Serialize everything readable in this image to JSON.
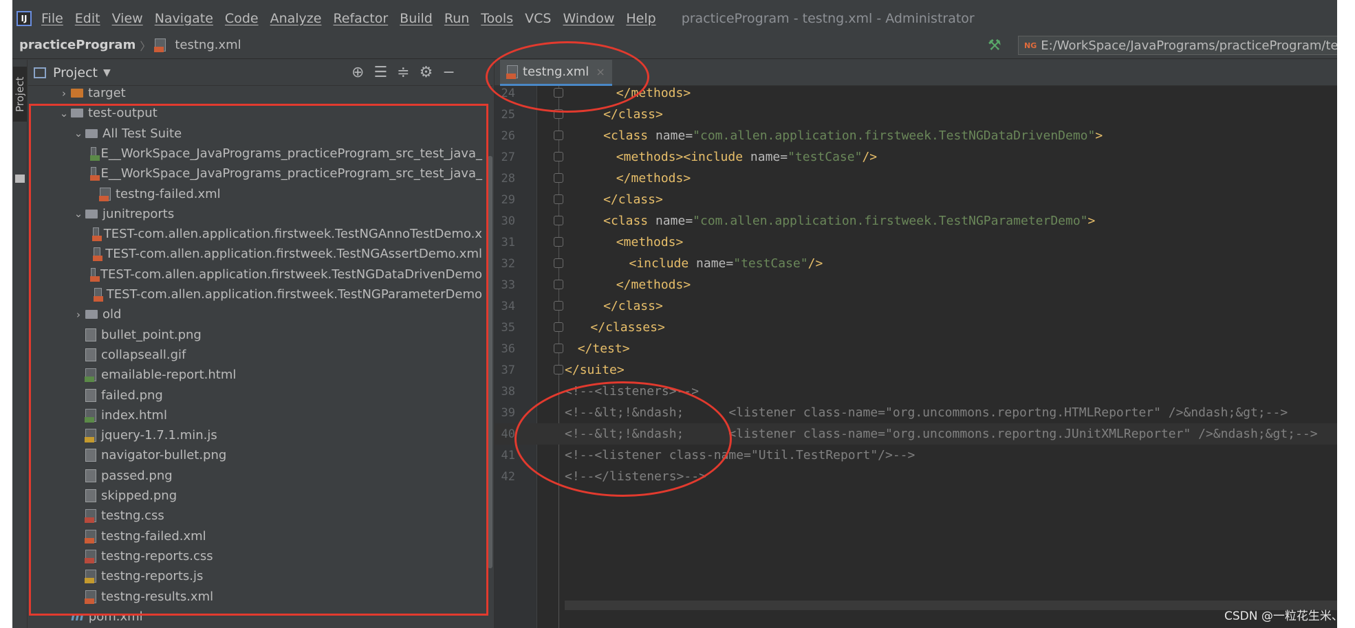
{
  "menubar": {
    "items": [
      "File",
      "Edit",
      "View",
      "Navigate",
      "Code",
      "Analyze",
      "Refactor",
      "Build",
      "Run",
      "Tools",
      "VCS",
      "Window",
      "Help"
    ],
    "window_title": "practiceProgram - testng.xml - Administrator"
  },
  "navbar": {
    "project": "practiceProgram",
    "file": "testng.xml",
    "run_config_path": "E:/WorkSpace/JavaPrograms/practiceProgram/te"
  },
  "stripe": {
    "label": "Project"
  },
  "project_panel": {
    "title": "Project",
    "tree": [
      {
        "label": "target",
        "kind": "folder-orange",
        "indent": 0,
        "chevron": "right"
      },
      {
        "label": "test-output",
        "kind": "folder",
        "indent": 0,
        "chevron": "down"
      },
      {
        "label": "All Test Suite",
        "kind": "folder",
        "indent": 1,
        "chevron": "down"
      },
      {
        "label": "E__WorkSpace_JavaPrograms_practiceProgram_src_test_java_",
        "kind": "html",
        "indent": 2,
        "chevron": ""
      },
      {
        "label": "E__WorkSpace_JavaPrograms_practiceProgram_src_test_java_",
        "kind": "xml",
        "indent": 2,
        "chevron": ""
      },
      {
        "label": "testng-failed.xml",
        "kind": "xml",
        "indent": 2,
        "chevron": ""
      },
      {
        "label": "junitreports",
        "kind": "folder",
        "indent": 1,
        "chevron": "down"
      },
      {
        "label": "TEST-com.allen.application.firstweek.TestNGAnnoTestDemo.x",
        "kind": "xml",
        "indent": 2,
        "chevron": ""
      },
      {
        "label": "TEST-com.allen.application.firstweek.TestNGAssertDemo.xml",
        "kind": "xml",
        "indent": 2,
        "chevron": ""
      },
      {
        "label": "TEST-com.allen.application.firstweek.TestNGDataDrivenDemo",
        "kind": "xml",
        "indent": 2,
        "chevron": ""
      },
      {
        "label": "TEST-com.allen.application.firstweek.TestNGParameterDemo",
        "kind": "xml",
        "indent": 2,
        "chevron": ""
      },
      {
        "label": "old",
        "kind": "folder",
        "indent": 1,
        "chevron": "right"
      },
      {
        "label": "bullet_point.png",
        "kind": "png",
        "indent": 1,
        "chevron": ""
      },
      {
        "label": "collapseall.gif",
        "kind": "png",
        "indent": 1,
        "chevron": ""
      },
      {
        "label": "emailable-report.html",
        "kind": "html",
        "indent": 1,
        "chevron": ""
      },
      {
        "label": "failed.png",
        "kind": "png",
        "indent": 1,
        "chevron": ""
      },
      {
        "label": "index.html",
        "kind": "html",
        "indent": 1,
        "chevron": ""
      },
      {
        "label": "jquery-1.7.1.min.js",
        "kind": "js",
        "indent": 1,
        "chevron": ""
      },
      {
        "label": "navigator-bullet.png",
        "kind": "png",
        "indent": 1,
        "chevron": ""
      },
      {
        "label": "passed.png",
        "kind": "png",
        "indent": 1,
        "chevron": ""
      },
      {
        "label": "skipped.png",
        "kind": "png",
        "indent": 1,
        "chevron": ""
      },
      {
        "label": "testng.css",
        "kind": "css",
        "indent": 1,
        "chevron": ""
      },
      {
        "label": "testng-failed.xml",
        "kind": "xml",
        "indent": 1,
        "chevron": ""
      },
      {
        "label": "testng-reports.css",
        "kind": "css",
        "indent": 1,
        "chevron": ""
      },
      {
        "label": "testng-reports.js",
        "kind": "js",
        "indent": 1,
        "chevron": ""
      },
      {
        "label": "testng-results.xml",
        "kind": "xml",
        "indent": 1,
        "chevron": ""
      },
      {
        "label": "pom.xml",
        "kind": "maven",
        "indent": 0,
        "chevron": ""
      }
    ]
  },
  "editor": {
    "tab": "testng.xml",
    "current_line": "40",
    "lines": [
      {
        "n": "24",
        "indent": 8,
        "parts": [
          [
            "br",
            "</"
          ],
          [
            "tag",
            "methods"
          ],
          [
            "br",
            ">"
          ]
        ]
      },
      {
        "n": "25",
        "indent": 6,
        "parts": [
          [
            "br",
            "</"
          ],
          [
            "tag",
            "class"
          ],
          [
            "br",
            ">"
          ]
        ]
      },
      {
        "n": "26",
        "indent": 6,
        "parts": [
          [
            "br",
            "<"
          ],
          [
            "tag",
            "class "
          ],
          [
            "attr",
            "name="
          ],
          [
            "val",
            "\"com.allen.application.firstweek.TestNGDataDrivenDemo\""
          ],
          [
            "br",
            ">"
          ]
        ]
      },
      {
        "n": "27",
        "indent": 8,
        "parts": [
          [
            "br",
            "<"
          ],
          [
            "tag",
            "methods"
          ],
          [
            "br",
            "><"
          ],
          [
            "tag",
            "include "
          ],
          [
            "attr",
            "name="
          ],
          [
            "val",
            "\"testCase\""
          ],
          [
            "br",
            "/>"
          ]
        ]
      },
      {
        "n": "28",
        "indent": 8,
        "parts": [
          [
            "br",
            "</"
          ],
          [
            "tag",
            "methods"
          ],
          [
            "br",
            ">"
          ]
        ]
      },
      {
        "n": "29",
        "indent": 6,
        "parts": [
          [
            "br",
            "</"
          ],
          [
            "tag",
            "class"
          ],
          [
            "br",
            ">"
          ]
        ]
      },
      {
        "n": "30",
        "indent": 6,
        "parts": [
          [
            "br",
            "<"
          ],
          [
            "tag",
            "class "
          ],
          [
            "attr",
            "name="
          ],
          [
            "val",
            "\"com.allen.application.firstweek.TestNGParameterDemo\""
          ],
          [
            "br",
            ">"
          ]
        ]
      },
      {
        "n": "31",
        "indent": 8,
        "parts": [
          [
            "br",
            "<"
          ],
          [
            "tag",
            "methods"
          ],
          [
            "br",
            ">"
          ]
        ]
      },
      {
        "n": "32",
        "indent": 10,
        "parts": [
          [
            "br",
            "<"
          ],
          [
            "tag",
            "include "
          ],
          [
            "attr",
            "name="
          ],
          [
            "val",
            "\"testCase\""
          ],
          [
            "br",
            "/>"
          ]
        ]
      },
      {
        "n": "33",
        "indent": 8,
        "parts": [
          [
            "br",
            "</"
          ],
          [
            "tag",
            "methods"
          ],
          [
            "br",
            ">"
          ]
        ]
      },
      {
        "n": "34",
        "indent": 6,
        "parts": [
          [
            "br",
            "</"
          ],
          [
            "tag",
            "class"
          ],
          [
            "br",
            ">"
          ]
        ]
      },
      {
        "n": "35",
        "indent": 4,
        "parts": [
          [
            "br",
            "</"
          ],
          [
            "tag",
            "classes"
          ],
          [
            "br",
            ">"
          ]
        ]
      },
      {
        "n": "36",
        "indent": 2,
        "parts": [
          [
            "br",
            "</"
          ],
          [
            "tag",
            "test"
          ],
          [
            "br",
            ">"
          ]
        ]
      },
      {
        "n": "37",
        "indent": 0,
        "parts": [
          [
            "br",
            "</"
          ],
          [
            "tag",
            "suite"
          ],
          [
            "br",
            ">"
          ]
        ]
      },
      {
        "n": "38",
        "indent": 0,
        "parts": [
          [
            "cmt",
            "<!--<listeners>-->"
          ]
        ]
      },
      {
        "n": "39",
        "indent": 0,
        "parts": [
          [
            "cmt",
            "<!--&lt;!&ndash;      <listener class-name=\"org.uncommons.reportng.HTMLReporter\" />&ndash;&gt;-->"
          ]
        ]
      },
      {
        "n": "40",
        "indent": 0,
        "parts": [
          [
            "cmt",
            "<!--&lt;!&ndash;      <listener class-name=\"org.uncommons.reportng.JUnitXMLReporter\" />&ndash;&gt;-->"
          ]
        ]
      },
      {
        "n": "41",
        "indent": 0,
        "parts": [
          [
            "cmt",
            "<!--<listener class-name=\"Util.TestReport\"/>-->"
          ]
        ]
      },
      {
        "n": "42",
        "indent": 0,
        "parts": [
          [
            "cmt",
            "<!--</listeners>-->"
          ]
        ]
      }
    ]
  },
  "watermark": "CSDN @一粒花生米、",
  "colors": {
    "annotation": "#e23a2e",
    "tag": "#e8bf6a",
    "value": "#6a8759",
    "comment": "#808080"
  }
}
